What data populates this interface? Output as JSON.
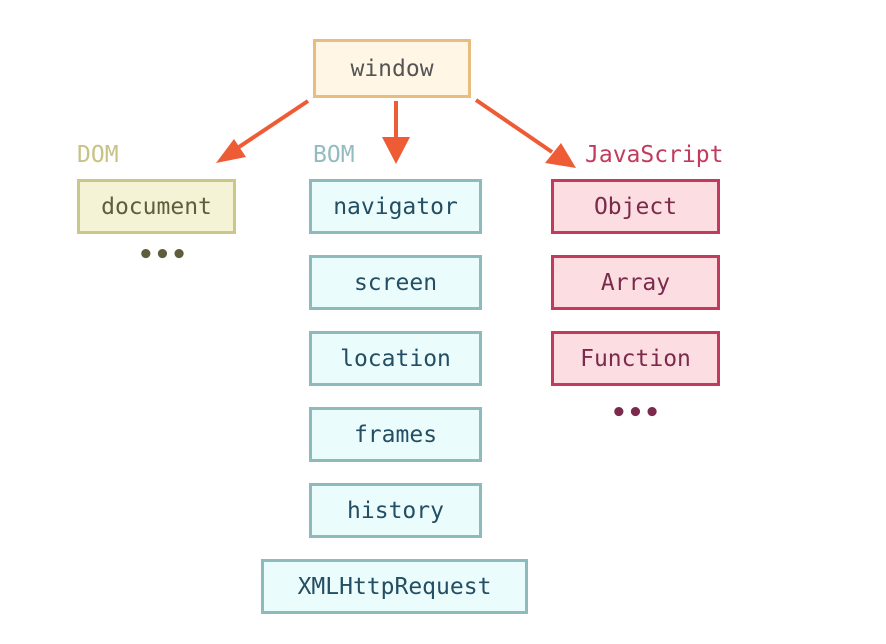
{
  "colors": {
    "arrow": "#ee5c35",
    "window": "#e8bd7f",
    "dom": "#c9c78a",
    "bom": "#8fbabb",
    "javascript": "#c23a5c"
  },
  "root": "window",
  "groups": {
    "dom": {
      "label": "DOM",
      "items": [
        "document"
      ],
      "more": "..."
    },
    "bom": {
      "label": "BOM",
      "items": [
        "navigator",
        "screen",
        "location",
        "frames",
        "history",
        "XMLHttpRequest"
      ]
    },
    "javascript": {
      "label": "JavaScript",
      "items": [
        "Object",
        "Array",
        "Function"
      ],
      "more": "..."
    }
  }
}
